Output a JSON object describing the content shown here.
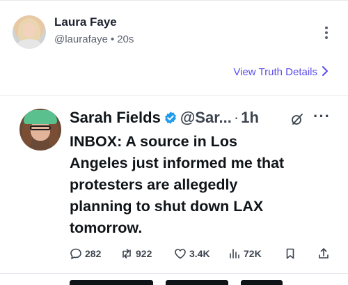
{
  "truth": {
    "author_name": "Laura Faye",
    "handle": "@laurafaye",
    "separator": "•",
    "time": "20s",
    "view_details_label": "View Truth Details"
  },
  "tweet": {
    "author_name": "Sarah Fields",
    "handle": "@Sar...",
    "separator": "·",
    "time": "1h",
    "more": "···",
    "text_lines": [
      "INBOX: A source in Los",
      "Angeles just informed me that",
      "protesters are allegedly",
      "planning to shut down LAX",
      "tomorrow."
    ],
    "replies": "282",
    "reposts": "922",
    "likes": "3.4K",
    "views": "72K"
  },
  "colors": {
    "accent_link": "#5a4ee8",
    "verified_blue": "#1d9bf0",
    "text_primary": "#0f1419",
    "text_secondary": "#3b434d",
    "divider": "#e7e9ee"
  }
}
